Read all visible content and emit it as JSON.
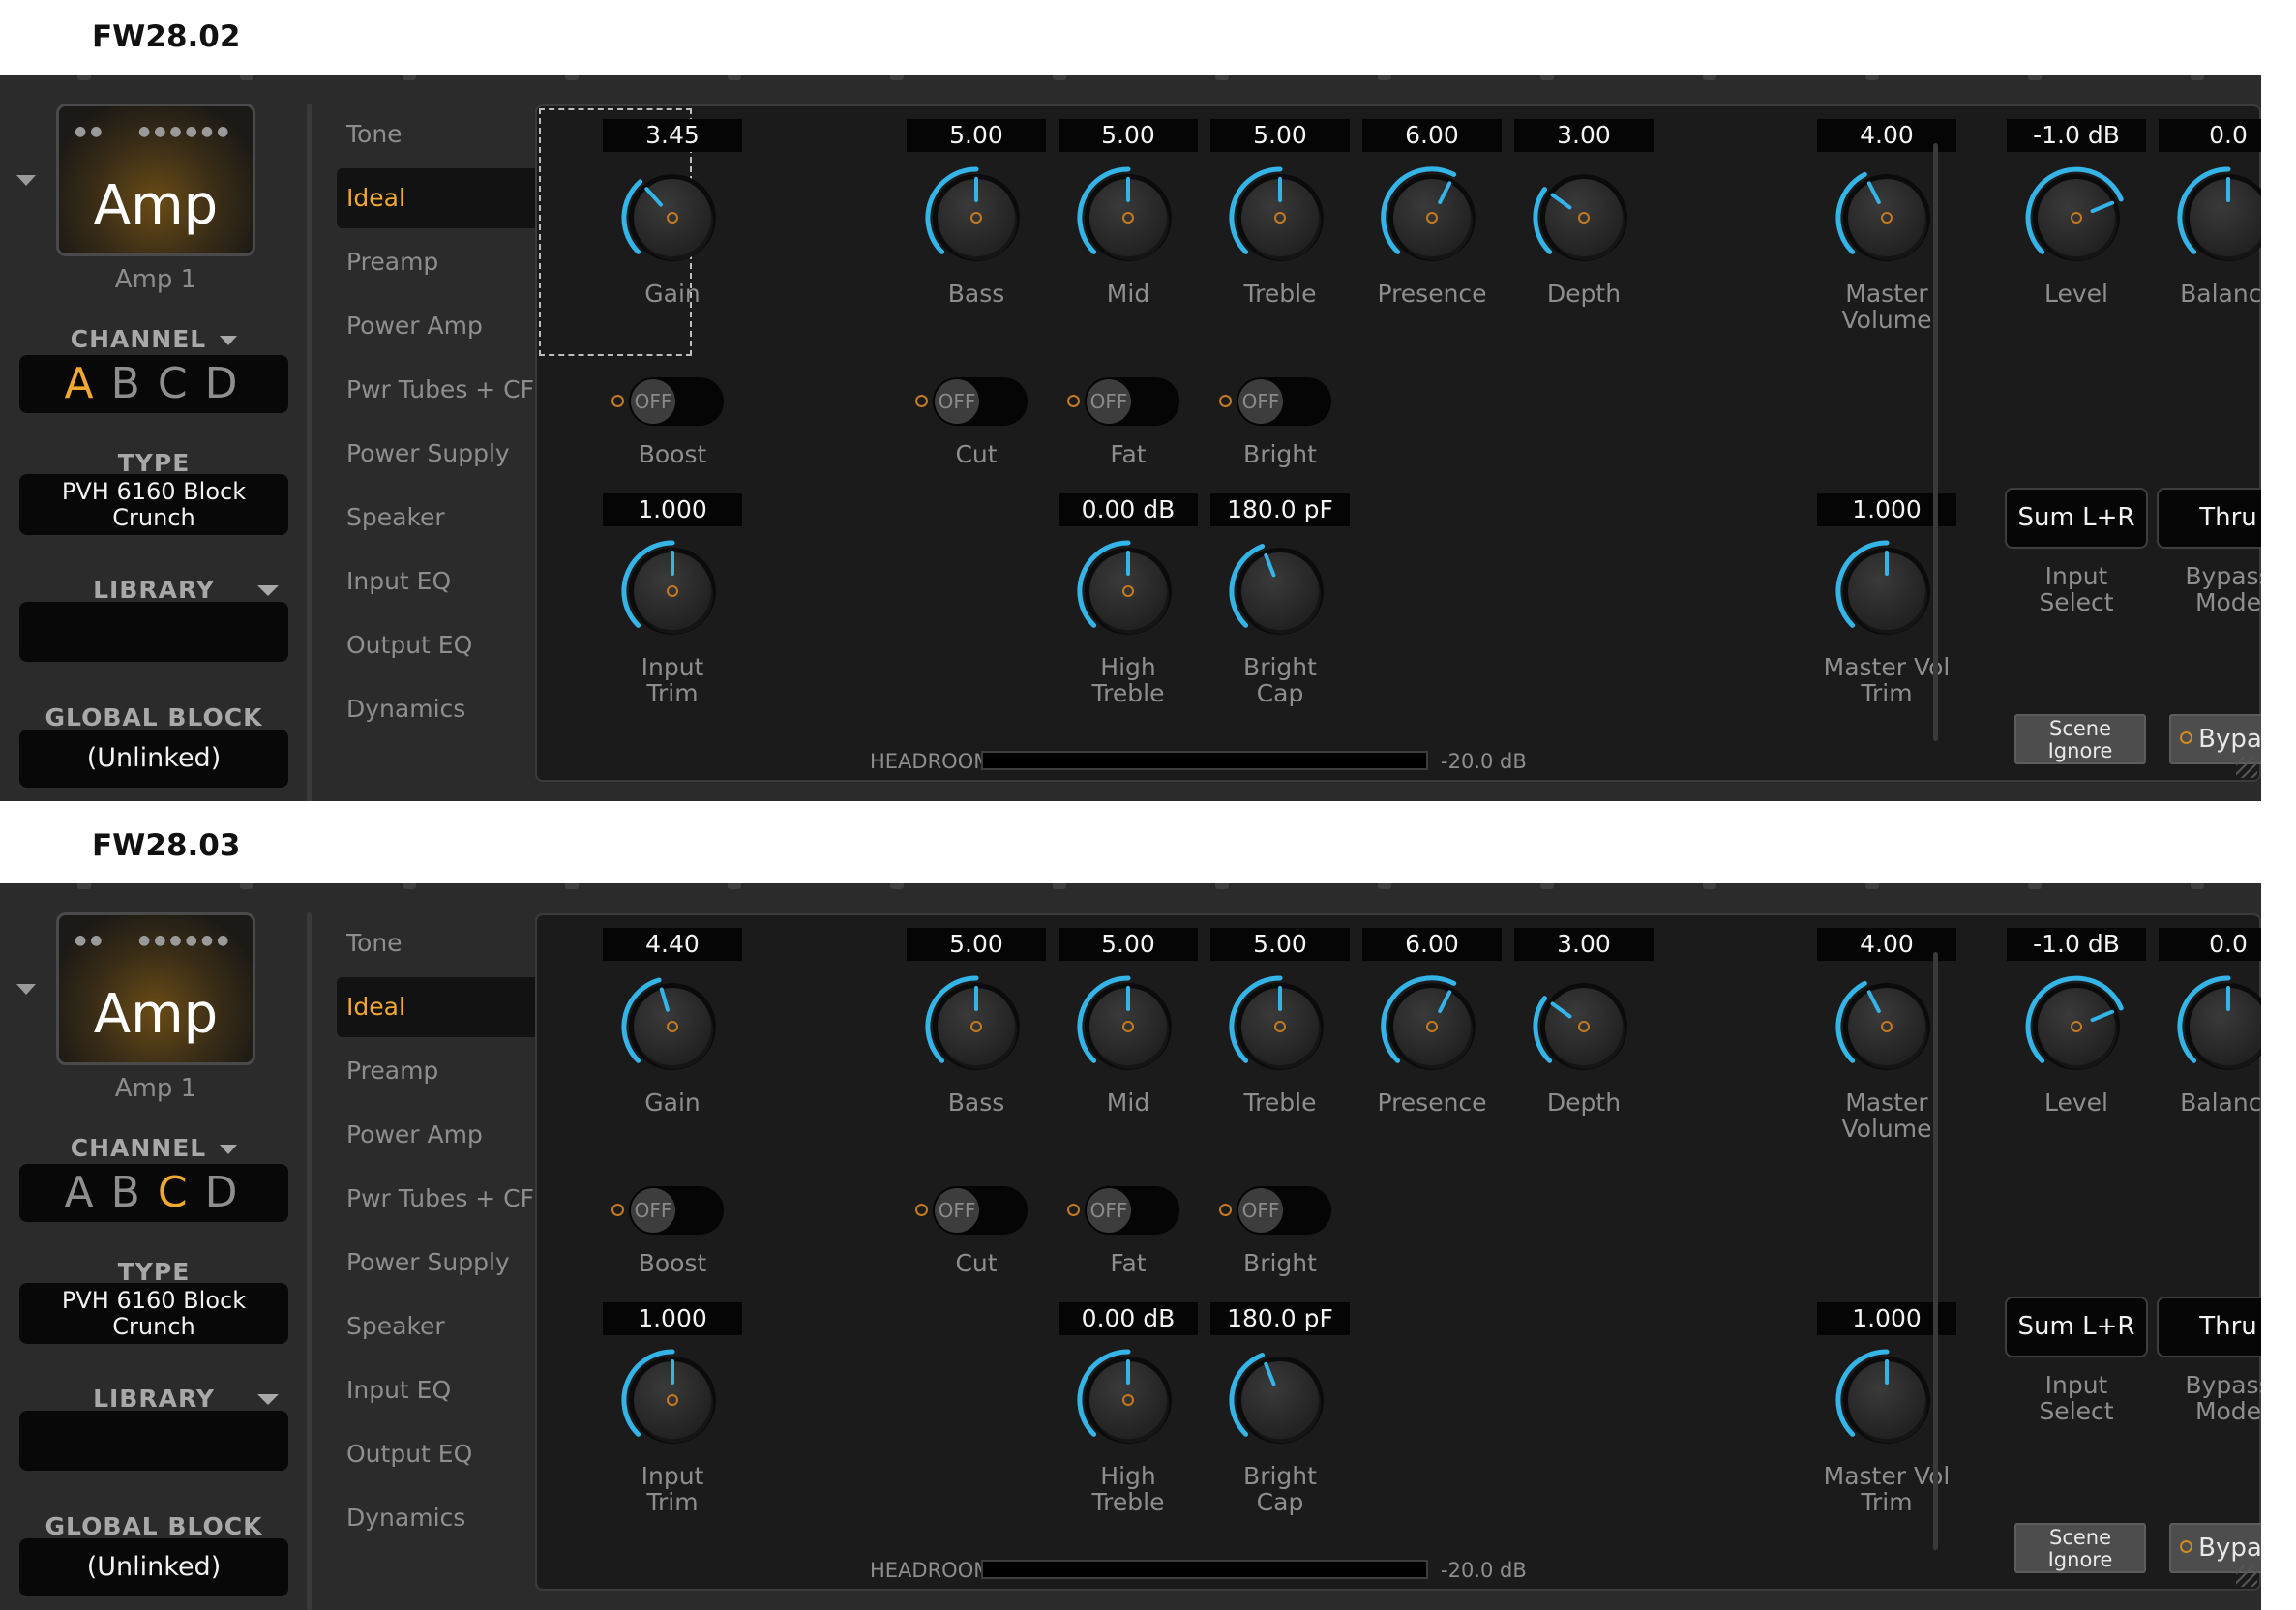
{
  "colors": {
    "accent_orange": "#f0a830",
    "knob_arc_blue": "#35b4e8",
    "panel_bg": "#2b2b2b",
    "main_bg": "#1b1b1b"
  },
  "panels": [
    {
      "fw_label": "FW28.02",
      "amp_logo": "Amp",
      "amp_name": "Amp 1",
      "channel_label": "CHANNEL",
      "channels": [
        "A",
        "B",
        "C",
        "D"
      ],
      "active_channel": "A",
      "type_label": "TYPE",
      "type_line1": "PVH 6160 Block",
      "type_line2": "Crunch",
      "library_label": "LIBRARY",
      "library_value": "",
      "global_block_label": "GLOBAL BLOCK",
      "global_block_value": "(Unlinked)",
      "menu": [
        "Tone",
        "Ideal",
        "Preamp",
        "Power Amp",
        "Pwr Tubes + CF",
        "Power Supply",
        "Speaker",
        "Input EQ",
        "Output EQ",
        "Dynamics"
      ],
      "active_menu": "Ideal",
      "gain_focused": true,
      "knobs": {
        "gain": {
          "value": "3.45",
          "label": "Gain",
          "fraction": 0.345
        },
        "bass": {
          "value": "5.00",
          "label": "Bass",
          "fraction": 0.5
        },
        "mid": {
          "value": "5.00",
          "label": "Mid",
          "fraction": 0.5
        },
        "treble": {
          "value": "5.00",
          "label": "Treble",
          "fraction": 0.5
        },
        "presence": {
          "value": "6.00",
          "label": "Presence",
          "fraction": 0.6
        },
        "depth": {
          "value": "3.00",
          "label": "Depth",
          "fraction": 0.3
        },
        "master_volume": {
          "value": "4.00",
          "label_line1": "Master",
          "label_line2": "Volume",
          "fraction": 0.4
        },
        "level": {
          "value": "-1.0 dB",
          "label": "Level",
          "fraction": 0.75
        },
        "balance": {
          "value": "0.0",
          "label": "Balance",
          "fraction": 0.5
        },
        "input_trim": {
          "value": "1.000",
          "label_line1": "Input",
          "label_line2": "Trim",
          "fraction": 0.5
        },
        "high_treble": {
          "value": "0.00 dB",
          "label_line1": "High",
          "label_line2": "Treble",
          "fraction": 0.5
        },
        "bright_cap": {
          "value": "180.0 pF",
          "label_line1": "Bright",
          "label_line2": "Cap",
          "fraction": 0.42
        },
        "master_vol_trim": {
          "value": "1.000",
          "label_line1": "Master Vol",
          "label_line2": "Trim",
          "fraction": 0.5
        }
      },
      "toggles": {
        "boost": {
          "state": "OFF",
          "label": "Boost"
        },
        "cut": {
          "state": "OFF",
          "label": "Cut"
        },
        "fat": {
          "state": "OFF",
          "label": "Fat"
        },
        "bright": {
          "state": "OFF",
          "label": "Bright"
        }
      },
      "input_select": {
        "value": "Sum L+R",
        "label_line1": "Input",
        "label_line2": "Select"
      },
      "bypass_mode": {
        "value": "Thru",
        "label_line1": "Bypass",
        "label_line2": "Mode"
      },
      "scene_ignore_line1": "Scene",
      "scene_ignore_line2": "Ignore",
      "bypass_button": "Bypass",
      "headroom_label": "HEADROOM",
      "headroom_value": "-20.0 dB"
    },
    {
      "fw_label": "FW28.03",
      "amp_logo": "Amp",
      "amp_name": "Amp 1",
      "channel_label": "CHANNEL",
      "channels": [
        "A",
        "B",
        "C",
        "D"
      ],
      "active_channel": "C",
      "type_label": "TYPE",
      "type_line1": "PVH 6160 Block",
      "type_line2": "Crunch",
      "library_label": "LIBRARY",
      "library_value": "",
      "global_block_label": "GLOBAL BLOCK",
      "global_block_value": "(Unlinked)",
      "menu": [
        "Tone",
        "Ideal",
        "Preamp",
        "Power Amp",
        "Pwr Tubes + CF",
        "Power Supply",
        "Speaker",
        "Input EQ",
        "Output EQ",
        "Dynamics"
      ],
      "active_menu": "Ideal",
      "gain_focused": false,
      "knobs": {
        "gain": {
          "value": "4.40",
          "label": "Gain",
          "fraction": 0.44
        },
        "bass": {
          "value": "5.00",
          "label": "Bass",
          "fraction": 0.5
        },
        "mid": {
          "value": "5.00",
          "label": "Mid",
          "fraction": 0.5
        },
        "treble": {
          "value": "5.00",
          "label": "Treble",
          "fraction": 0.5
        },
        "presence": {
          "value": "6.00",
          "label": "Presence",
          "fraction": 0.6
        },
        "depth": {
          "value": "3.00",
          "label": "Depth",
          "fraction": 0.3
        },
        "master_volume": {
          "value": "4.00",
          "label_line1": "Master",
          "label_line2": "Volume",
          "fraction": 0.4
        },
        "level": {
          "value": "-1.0 dB",
          "label": "Level",
          "fraction": 0.75
        },
        "balance": {
          "value": "0.0",
          "label": "Balance",
          "fraction": 0.5
        },
        "input_trim": {
          "value": "1.000",
          "label_line1": "Input",
          "label_line2": "Trim",
          "fraction": 0.5
        },
        "high_treble": {
          "value": "0.00 dB",
          "label_line1": "High",
          "label_line2": "Treble",
          "fraction": 0.5
        },
        "bright_cap": {
          "value": "180.0 pF",
          "label_line1": "Bright",
          "label_line2": "Cap",
          "fraction": 0.42
        },
        "master_vol_trim": {
          "value": "1.000",
          "label_line1": "Master Vol",
          "label_line2": "Trim",
          "fraction": 0.5
        }
      },
      "toggles": {
        "boost": {
          "state": "OFF",
          "label": "Boost"
        },
        "cut": {
          "state": "OFF",
          "label": "Cut"
        },
        "fat": {
          "state": "OFF",
          "label": "Fat"
        },
        "bright": {
          "state": "OFF",
          "label": "Bright"
        }
      },
      "input_select": {
        "value": "Sum L+R",
        "label_line1": "Input",
        "label_line2": "Select"
      },
      "bypass_mode": {
        "value": "Thru",
        "label_line1": "Bypass",
        "label_line2": "Mode"
      },
      "scene_ignore_line1": "Scene",
      "scene_ignore_line2": "Ignore",
      "bypass_button": "Bypass",
      "headroom_label": "HEADROOM",
      "headroom_value": "-20.0 dB"
    }
  ]
}
